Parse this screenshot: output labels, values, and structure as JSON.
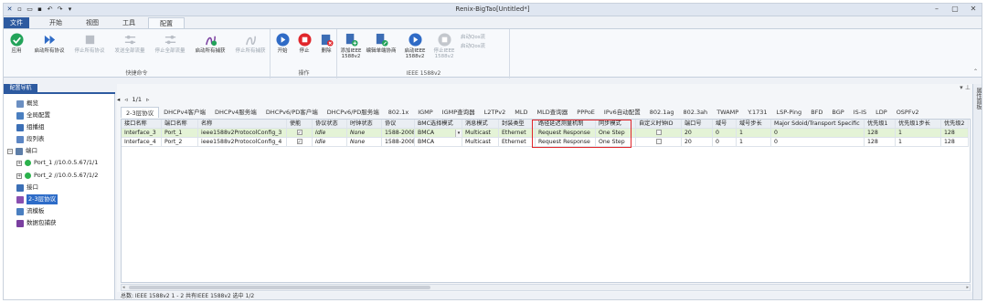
{
  "window": {
    "title": "Renix-BigTao[Untitled*]"
  },
  "ribbon_tabs": [
    "文件",
    "开始",
    "视图",
    "工具",
    "配置"
  ],
  "ribbon": {
    "groups": [
      {
        "label": "快捷命令",
        "buttons": [
          "应用",
          "启动所有协议",
          "停止所有协议",
          "发送全部流量",
          "停止全部流量",
          "启动所有捕获",
          "停止所有捕获"
        ]
      },
      {
        "label": "操作",
        "buttons": [
          "开始",
          "停止",
          "删除"
        ]
      },
      {
        "label": "IEEE 1588v2",
        "buttons": [
          "添加IEEE 1588v2",
          "编辑单端协商",
          "启动IEEE 1588v2",
          "停止IEEE 1588v2"
        ]
      }
    ],
    "small_items": [
      "启动Qos流",
      "启动Qos流"
    ]
  },
  "left_panel": {
    "tab": "配置导航",
    "items": [
      "概览",
      "全局配置",
      "组播组",
      "段列表",
      "端口",
      "Port_1 //10.0.5.67/1/1",
      "Port_2 //10.0.5.67/1/2",
      "接口",
      "2-3层协议",
      "流模板",
      "数据包捕获"
    ]
  },
  "main": {
    "pager": "1/1",
    "protocol_tabs": [
      "2-3层协议",
      "DHCPv4客户端",
      "DHCPv4服务端",
      "DHCPv6/PD客户端",
      "DHCPv6/PD服务端",
      "802.1x",
      "IGMP",
      "IGMP查询器",
      "L2TPv2",
      "MLD",
      "MLD查询器",
      "PPPoE",
      "IPv6自动配置",
      "802.1ag",
      "802.3ah",
      "TWAMP",
      "Y.1731",
      "LSP-Ping",
      "BFD",
      "BGP",
      "IS-IS",
      "LDP",
      "OSPFv2"
    ],
    "columns": [
      "接口名称",
      "端口名称",
      "名称",
      "使能",
      "协议状态",
      "时钟状态",
      "协议",
      "BMC选择模式",
      "消息模式",
      "封装类型",
      "路径延迟测量机制",
      "同步模式",
      "自定义时钟ID",
      "端口号",
      "域号",
      "域号步长",
      "Major Sdoid/Transport Specific",
      "优先级1",
      "优先级1步长",
      "优先级2"
    ],
    "rows": [
      [
        "Interface_3",
        "Port_1",
        "ieee1588v2ProtocolConfig_3",
        "",
        "Idle",
        "None",
        "1588-2008",
        "BMCA",
        "Multicast",
        "Ethernet",
        "Request Response",
        "One Step",
        "",
        "20",
        "0",
        "1",
        "0",
        "128",
        "1",
        "128"
      ],
      [
        "Interface_4",
        "Port_2",
        "ieee1588v2ProtocolConfig_4",
        "",
        "Idle",
        "None",
        "1588-2008",
        "BMCA",
        "Multicast",
        "Ethernet",
        "Request Response",
        "One Step",
        "",
        "20",
        "0",
        "1",
        "0",
        "128",
        "1",
        "128"
      ]
    ]
  },
  "status_bar": "总数: IEEE 1588v2 1 - 2 共有IEEE 1588v2 选中 1/2",
  "right_strip": "属性面板"
}
